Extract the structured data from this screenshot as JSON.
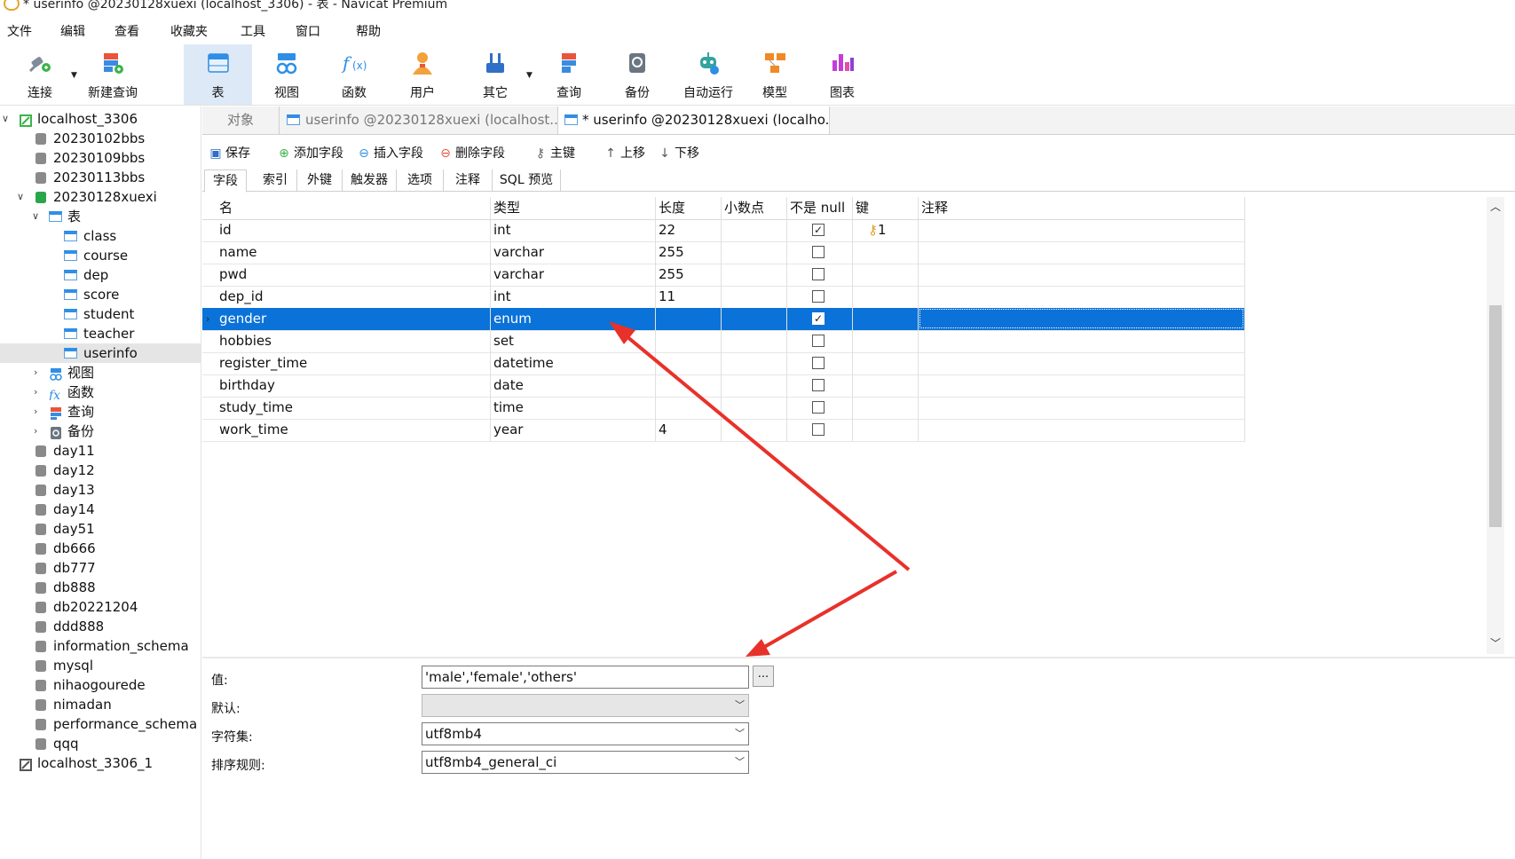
{
  "window": {
    "title": "* userinfo @20230128xuexi (localhost_3306) - 表 - Navicat Premium"
  },
  "menu": [
    "文件",
    "编辑",
    "查看",
    "收藏夹",
    "工具",
    "窗口",
    "帮助"
  ],
  "toolbar": [
    {
      "label": "连接",
      "icon": "plug-icon"
    },
    {
      "label": "新建查询",
      "icon": "new-query-icon"
    },
    {
      "label": "表",
      "icon": "table-icon",
      "active": true
    },
    {
      "label": "视图",
      "icon": "view-icon"
    },
    {
      "label": "函数",
      "icon": "function-icon"
    },
    {
      "label": "用户",
      "icon": "user-icon"
    },
    {
      "label": "其它",
      "icon": "tools-icon"
    },
    {
      "label": "查询",
      "icon": "query-icon"
    },
    {
      "label": "备份",
      "icon": "backup-icon"
    },
    {
      "label": "自动运行",
      "icon": "robot-icon"
    },
    {
      "label": "模型",
      "icon": "model-icon"
    },
    {
      "label": "图表",
      "icon": "chart-icon"
    }
  ],
  "tree": {
    "connection": "localhost_3306",
    "databases_top": [
      "20230102bbs",
      "20230109bbs",
      "20230113bbs"
    ],
    "open_db": "20230128xuexi",
    "tables_node": "表",
    "tables": [
      "class",
      "course",
      "dep",
      "score",
      "student",
      "teacher",
      "userinfo"
    ],
    "groups": [
      "视图",
      "函数",
      "查询",
      "备份"
    ],
    "databases_bottom": [
      "day11",
      "day12",
      "day13",
      "day14",
      "day51",
      "db666",
      "db777",
      "db888",
      "db20221204",
      "ddd888",
      "information_schema",
      "mysql",
      "nihaogourede",
      "nimadan",
      "performance_schema",
      "qqq"
    ],
    "connection2": "localhost_3306_1"
  },
  "tabs": {
    "objects": "对象",
    "tab1": "userinfo @20230128xuexi (localhost...",
    "tab2": "* userinfo @20230128xuexi (localho..."
  },
  "actions": [
    "保存",
    "添加字段",
    "插入字段",
    "删除字段",
    "主键",
    "上移",
    "下移"
  ],
  "subtabs": [
    "字段",
    "索引",
    "外键",
    "触发器",
    "选项",
    "注释",
    "SQL 预览"
  ],
  "grid": {
    "headers": [
      "名",
      "类型",
      "长度",
      "小数点",
      "不是 null",
      "键",
      "注释"
    ],
    "rows": [
      {
        "name": "id",
        "type": "int",
        "length": "22",
        "decimals": "",
        "notnull": true,
        "key": "1",
        "comment": ""
      },
      {
        "name": "name",
        "type": "varchar",
        "length": "255",
        "decimals": "",
        "notnull": false,
        "key": "",
        "comment": ""
      },
      {
        "name": "pwd",
        "type": "varchar",
        "length": "255",
        "decimals": "",
        "notnull": false,
        "key": "",
        "comment": ""
      },
      {
        "name": "dep_id",
        "type": "int",
        "length": "11",
        "decimals": "",
        "notnull": false,
        "key": "",
        "comment": ""
      },
      {
        "name": "gender",
        "type": "enum",
        "length": "",
        "decimals": "",
        "notnull": true,
        "key": "",
        "comment": "",
        "selected": true
      },
      {
        "name": "hobbies",
        "type": "set",
        "length": "",
        "decimals": "",
        "notnull": false,
        "key": "",
        "comment": ""
      },
      {
        "name": "register_time",
        "type": "datetime",
        "length": "",
        "decimals": "",
        "notnull": false,
        "key": "",
        "comment": ""
      },
      {
        "name": "birthday",
        "type": "date",
        "length": "",
        "decimals": "",
        "notnull": false,
        "key": "",
        "comment": ""
      },
      {
        "name": "study_time",
        "type": "time",
        "length": "",
        "decimals": "",
        "notnull": false,
        "key": "",
        "comment": ""
      },
      {
        "name": "work_time",
        "type": "year",
        "length": "4",
        "decimals": "",
        "notnull": false,
        "key": "",
        "comment": ""
      }
    ]
  },
  "props": {
    "value_label": "值:",
    "value": "'male','female','others'",
    "ellipsis": "...",
    "default_label": "默认:",
    "default_value": "",
    "charset_label": "字符集:",
    "charset_value": "utf8mb4",
    "collation_label": "排序规则:",
    "collation_value": "utf8mb4_general_ci"
  },
  "colors": {
    "selection": "#0a72d8",
    "annotation_arrow": "#e8312a",
    "active_toolbar": "#dde9f6"
  }
}
